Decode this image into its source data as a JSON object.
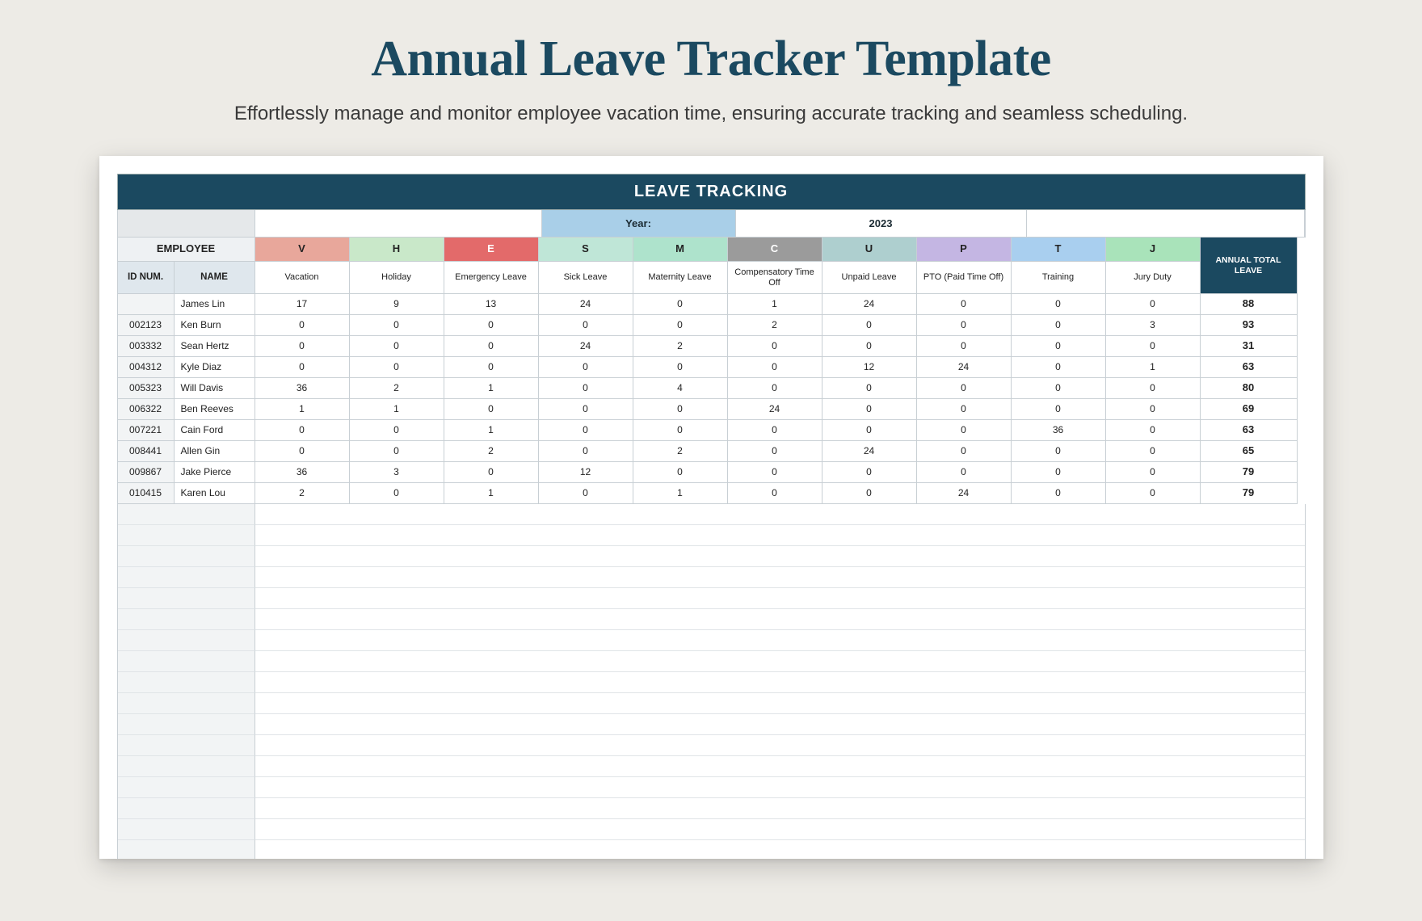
{
  "page": {
    "title": "Annual Leave Tracker Template",
    "subtitle": "Effortlessly manage and monitor employee vacation time, ensuring accurate tracking and seamless scheduling."
  },
  "tracker": {
    "banner": "LEAVE TRACKING",
    "year_label": "Year:",
    "year_value": "2023",
    "employee_header": "EMPLOYEE",
    "id_header": "ID NUM.",
    "name_header": "NAME",
    "total_header": "ANNUAL TOTAL LEAVE",
    "leave_types": [
      {
        "code": "V",
        "label": "Vacation",
        "class": "code-V"
      },
      {
        "code": "H",
        "label": "Holiday",
        "class": "code-H"
      },
      {
        "code": "E",
        "label": "Emergency Leave",
        "class": "code-E"
      },
      {
        "code": "S",
        "label": "Sick Leave",
        "class": "code-S"
      },
      {
        "code": "M",
        "label": "Maternity Leave",
        "class": "code-M"
      },
      {
        "code": "C",
        "label": "Compensatory Time Off",
        "class": "code-C"
      },
      {
        "code": "U",
        "label": "Unpaid Leave",
        "class": "code-U"
      },
      {
        "code": "P",
        "label": "PTO (Paid Time Off)",
        "class": "code-P"
      },
      {
        "code": "T",
        "label": "Training",
        "class": "code-T"
      },
      {
        "code": "J",
        "label": "Jury Duty",
        "class": "code-J"
      }
    ],
    "rows": [
      {
        "id": "",
        "name": "James Lin",
        "values": [
          17,
          9,
          13,
          24,
          0,
          1,
          24,
          0,
          0,
          0
        ],
        "total": 88
      },
      {
        "id": "002123",
        "name": "Ken Burn",
        "values": [
          0,
          0,
          0,
          0,
          0,
          2,
          0,
          0,
          0,
          3
        ],
        "total": 93
      },
      {
        "id": "003332",
        "name": "Sean Hertz",
        "values": [
          0,
          0,
          0,
          24,
          2,
          0,
          0,
          0,
          0,
          0
        ],
        "total": 31
      },
      {
        "id": "004312",
        "name": "Kyle Diaz",
        "values": [
          0,
          0,
          0,
          0,
          0,
          0,
          12,
          24,
          0,
          1
        ],
        "total": 63
      },
      {
        "id": "005323",
        "name": "Will Davis",
        "values": [
          36,
          2,
          1,
          0,
          4,
          0,
          0,
          0,
          0,
          0
        ],
        "total": 80
      },
      {
        "id": "006322",
        "name": "Ben Reeves",
        "values": [
          1,
          1,
          0,
          0,
          0,
          24,
          0,
          0,
          0,
          0
        ],
        "total": 69
      },
      {
        "id": "007221",
        "name": "Cain Ford",
        "values": [
          0,
          0,
          1,
          0,
          0,
          0,
          0,
          0,
          36,
          0
        ],
        "total": 63
      },
      {
        "id": "008441",
        "name": "Allen Gin",
        "values": [
          0,
          0,
          2,
          0,
          2,
          0,
          24,
          0,
          0,
          0
        ],
        "total": 65
      },
      {
        "id": "009867",
        "name": "Jake Pierce",
        "values": [
          36,
          3,
          0,
          12,
          0,
          0,
          0,
          0,
          0,
          0
        ],
        "total": 79
      },
      {
        "id": "010415",
        "name": "Karen Lou",
        "values": [
          2,
          0,
          1,
          0,
          1,
          0,
          0,
          24,
          0,
          0
        ],
        "total": 79
      }
    ],
    "empty_rows": 18
  }
}
